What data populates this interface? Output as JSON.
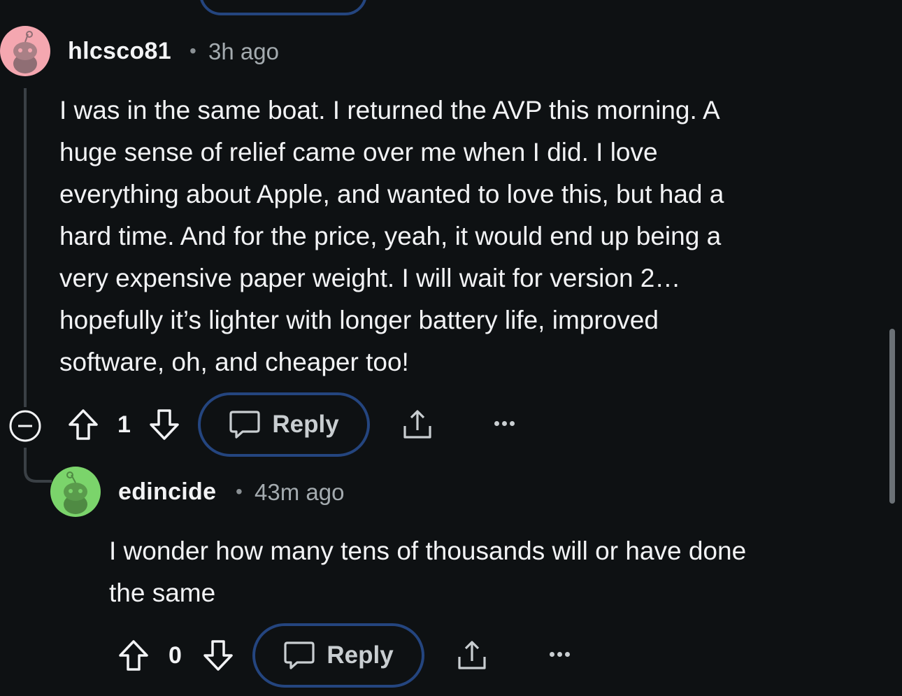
{
  "comments": [
    {
      "username": "hlcsco81",
      "separator": "•",
      "time": "3h ago",
      "body_lines": [
        "I was in the same boat. I returned the AVP this morning. A",
        "huge sense of relief came over me when I did. I love",
        "everything about Apple, and wanted to love this, but had a",
        "hard time. And for the price, yeah, it would end up being a",
        "very expensive paper weight. I will wait for version 2…",
        "hopefully it’s lighter with longer battery life, improved",
        "software, oh, and cheaper too!"
      ],
      "votes": "1",
      "reply_label": "Reply",
      "avatar_color": "#f4a7b0"
    },
    {
      "username": "edincide",
      "separator": "•",
      "time": "43m ago",
      "body_lines": [
        "I wonder how many tens of thousands will or have done",
        "the same"
      ],
      "votes": "0",
      "reply_label": "Reply",
      "avatar_color": "#7bd46b"
    }
  ],
  "colors": {
    "background": "#0e1113",
    "reply_border": "#24457f",
    "thread_line": "#3a4045"
  },
  "icons": [
    "collapse-icon",
    "upvote-icon",
    "downvote-icon",
    "comment-icon",
    "share-icon",
    "more-icon"
  ]
}
